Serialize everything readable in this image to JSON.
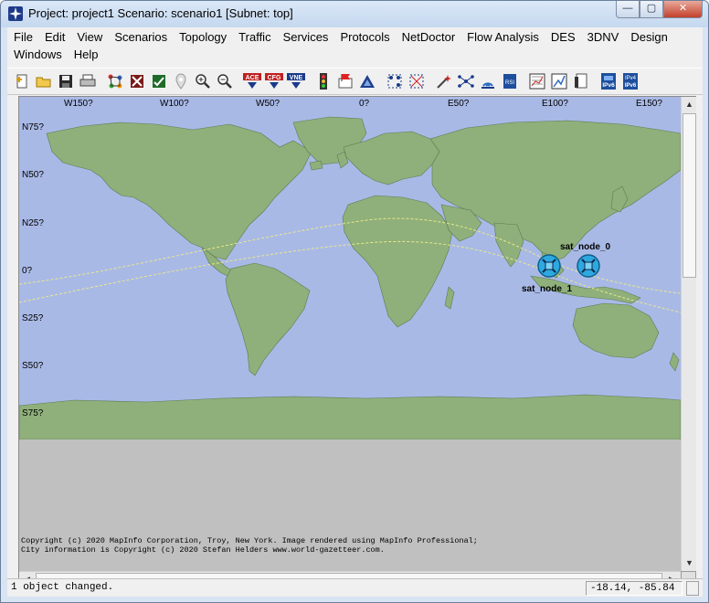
{
  "window": {
    "title": "Project: project1 Scenario: scenario1  [Subnet: top]",
    "controls": {
      "minimize": "—",
      "maximize": "▢",
      "close": "✕"
    }
  },
  "menubar": {
    "row1": [
      "File",
      "Edit",
      "View",
      "Scenarios",
      "Topology",
      "Traffic",
      "Services",
      "Protocols",
      "NetDoctor",
      "Flow Analysis",
      "DES",
      "3DNV",
      "Design"
    ],
    "row2": [
      "Windows",
      "Help"
    ]
  },
  "toolbar": {
    "icons": [
      "new-icon",
      "open-icon",
      "save-icon",
      "print-icon",
      "rapid-config-icon",
      "fail-node-icon",
      "recover-node-icon",
      "location-pin-icon",
      "zoom-in-icon",
      "zoom-out-icon",
      "ace-icon",
      "cfg-icon",
      "vne-icon",
      "traffic-light-icon",
      "flag-report-icon",
      "triangle-icon",
      "topology-grid-icon",
      "topology-grid-2-icon",
      "sparkle-icon",
      "network-icon",
      "signal-icon",
      "rsi-icon",
      "graph-icon",
      "chart-icon",
      "page-icon",
      "ipv6-icon",
      "ipv4-ipv6-icon"
    ],
    "labels": {
      "ace": "ACE",
      "cfg": "CFG",
      "vne": "VNE",
      "rsi": "RSI",
      "ipv6": "IPv6",
      "ipv4": "IPv4",
      "ipv6b": "IPv6"
    }
  },
  "map": {
    "x_ticks": [
      "W150?",
      "W100?",
      "W50?",
      "0?",
      "E50?",
      "E100?",
      "E150?"
    ],
    "y_ticks": [
      "N75?",
      "N50?",
      "N25?",
      "0?",
      "S25?",
      "S50?",
      "S75?"
    ],
    "colors": {
      "ocean": "#a9b9e6",
      "land": "#8fb07a",
      "coast": "#5e7a52",
      "orbit": "#e8e88a",
      "node": "#2ea8e0"
    },
    "nodes": [
      {
        "name": "sat_node_0"
      },
      {
        "name": "sat_node_1"
      }
    ],
    "copyright_line1": "Copyright (c) 2020 MapInfo Corporation, Troy, New York. Image rendered using MapInfo Professional;",
    "copyright_line2": "City information is Copyright (c) 2020 Stefan Helders www.world-gazetteer.com."
  },
  "status": {
    "message": "1 object changed.",
    "coordinates": "-18.14, -85.84"
  }
}
